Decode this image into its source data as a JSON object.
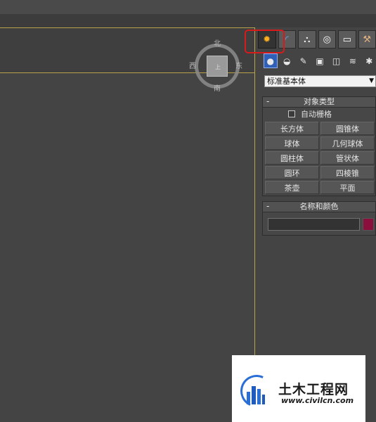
{
  "viewcube": {
    "north": "北",
    "south": "南",
    "east": "东",
    "west": "西",
    "face": "上"
  },
  "command_panel": {
    "tabs": [
      {
        "name": "create",
        "glyph": "✹",
        "active": true
      },
      {
        "name": "modify",
        "glyph": "◜",
        "active": false
      },
      {
        "name": "hierarchy",
        "glyph": "⛬",
        "active": false
      },
      {
        "name": "motion",
        "glyph": "◎",
        "active": false
      },
      {
        "name": "display",
        "glyph": "▭",
        "active": false
      },
      {
        "name": "utilities",
        "glyph": "⚒",
        "active": false
      }
    ],
    "subcategories": [
      {
        "name": "geometry",
        "glyph": "●",
        "active": true
      },
      {
        "name": "shapes",
        "glyph": "◒"
      },
      {
        "name": "lights",
        "glyph": "✎"
      },
      {
        "name": "cameras",
        "glyph": "▣"
      },
      {
        "name": "helpers",
        "glyph": "◫"
      },
      {
        "name": "space-warps",
        "glyph": "≋"
      },
      {
        "name": "systems",
        "glyph": "✱"
      }
    ],
    "category_dropdown": "标准基本体",
    "object_type": {
      "header": "对象类型",
      "autogrid_label": "自动栅格",
      "buttons": [
        "长方体",
        "圆锥体",
        "球体",
        "几何球体",
        "圆柱体",
        "管状体",
        "圆环",
        "四棱锥",
        "茶壶",
        "平面"
      ]
    },
    "name_and_color": {
      "header": "名称和颜色",
      "name_value": "",
      "color": "#8b0f3c"
    },
    "collapse_symbol": "-"
  },
  "watermark": {
    "title": "土木工程网",
    "url": "www.civilcn.com"
  },
  "colors": {
    "highlight": "#d71a1a",
    "viewport_border": "#b8a34a",
    "active_subicon": "#2f5fb6"
  }
}
